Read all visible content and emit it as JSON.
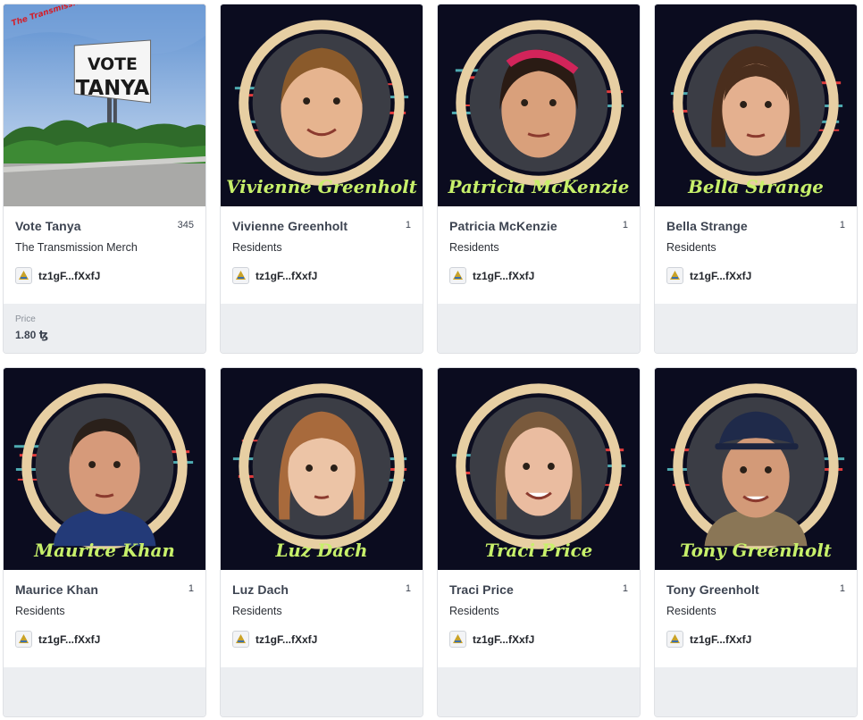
{
  "cards": [
    {
      "title": "Vote Tanya",
      "edition": "345",
      "collection": "The Transmission Merch",
      "owner": "tz1gF...fXxfJ",
      "price_label": "Price",
      "price": "1.80 ꜩ",
      "image": {
        "billboard_line1": "VOTE",
        "billboard_line2": "TANYA",
        "logo": "The Transmission"
      }
    },
    {
      "title": "Vivienne Greenholt",
      "edition": "1",
      "collection": "Residents",
      "owner": "tz1gF...fXxfJ",
      "image": {
        "caption": "Vivienne Greenholt"
      }
    },
    {
      "title": "Patricia McKenzie",
      "edition": "1",
      "collection": "Residents",
      "owner": "tz1gF...fXxfJ",
      "image": {
        "caption": "Patricia McKenzie"
      }
    },
    {
      "title": "Bella Strange",
      "edition": "1",
      "collection": "Residents",
      "owner": "tz1gF...fXxfJ",
      "image": {
        "caption": "Bella Strange"
      }
    },
    {
      "title": "Maurice Khan",
      "edition": "1",
      "collection": "Residents",
      "owner": "tz1gF...fXxfJ",
      "image": {
        "caption": "Maurice Khan"
      }
    },
    {
      "title": "Luz Dach",
      "edition": "1",
      "collection": "Residents",
      "owner": "tz1gF...fXxfJ",
      "image": {
        "caption": "Luz Dach"
      }
    },
    {
      "title": "Traci Price",
      "edition": "1",
      "collection": "Residents",
      "owner": "tz1gF...fXxfJ",
      "image": {
        "caption": "Traci Price"
      }
    },
    {
      "title": "Tony Greenholt",
      "edition": "1",
      "collection": "Residents",
      "owner": "tz1gF...fXxfJ",
      "image": {
        "caption": "Tony Greenholt"
      }
    }
  ],
  "colors": {
    "portrait_bg": "#0b0c1f",
    "ring": "#e7cfa3",
    "caption": "#c7f06a",
    "glitch_red": "#e23b3b",
    "glitch_cyan": "#5fd3d6",
    "footer": "#eceef1"
  }
}
